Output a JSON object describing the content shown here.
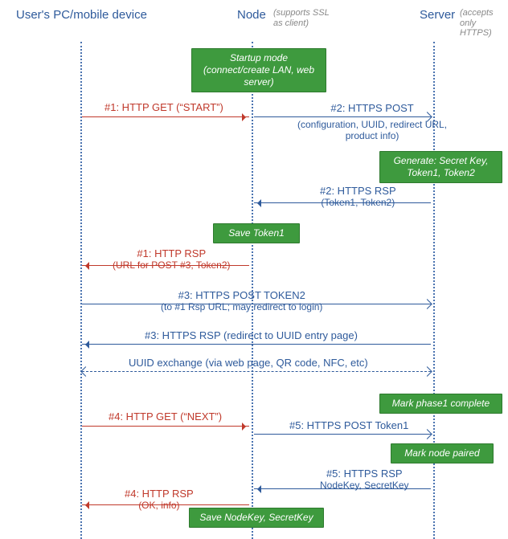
{
  "lanes": {
    "user": {
      "title": "User's PC/mobile device",
      "sub": ""
    },
    "node": {
      "title": "Node",
      "sub": "(supports SSL\nas client)"
    },
    "server": {
      "title": "Server",
      "sub": "(accepts\nonly HTTPS)"
    }
  },
  "boxes": {
    "startup": "Startup mode\n(connect/create LAN, web\nserver)",
    "gen": "Generate: Secret Key,\nToken1, Token2",
    "save1": "Save Token1",
    "phase1": "Mark phase1 complete",
    "paired": "Mark node paired",
    "save2": "Save NodeKey, SecretKey"
  },
  "messages": {
    "m1": {
      "t": "#1: HTTP GET (“START”)",
      "sub": ""
    },
    "m2": {
      "t": "#2: HTTPS POST",
      "sub": "(configuration, UUID, redirect URL,\nproduct info)"
    },
    "m2r": {
      "t": "#2: HTTPS RSP",
      "sub": "(Token1, Token2)"
    },
    "m1r": {
      "t": "#1: HTTP RSP",
      "sub": "(URL for POST #3, Token2)"
    },
    "m3": {
      "t": "#3: HTTPS POST TOKEN2",
      "sub": "(to #1 Rsp URL; may redirect to login)"
    },
    "m3r": {
      "t": "#3: HTTPS RSP (redirect to UUID entry page)",
      "sub": ""
    },
    "uuid": {
      "t": "UUID exchange (via web page, QR code, NFC, etc)",
      "sub": ""
    },
    "m4": {
      "t": "#4: HTTP GET (“NEXT”)",
      "sub": ""
    },
    "m5": {
      "t": "#5: HTTPS POST Token1",
      "sub": ""
    },
    "m5r": {
      "t": "#5: HTTPS RSP",
      "sub": "NodeKey, SecretKey"
    },
    "m4r": {
      "t": "#4: HTTP RSP",
      "sub": "(OK, info)"
    }
  },
  "chart_data": {
    "type": "sequence-diagram",
    "actors": [
      "User's PC/mobile device",
      "Node",
      "Server"
    ],
    "actor_notes": {
      "Node": "supports SSL as client",
      "Server": "accepts only HTTPS"
    },
    "steps": [
      {
        "kind": "state",
        "actor": "Node",
        "text": "Startup mode (connect/create LAN, web server)"
      },
      {
        "kind": "msg",
        "from": "User's PC/mobile device",
        "to": "Node",
        "proto": "HTTP",
        "label": "#1: HTTP GET (\"START\")"
      },
      {
        "kind": "msg",
        "from": "Node",
        "to": "Server",
        "proto": "HTTPS",
        "label": "#2: HTTPS POST",
        "detail": "configuration, UUID, redirect URL, product info"
      },
      {
        "kind": "state",
        "actor": "Server",
        "text": "Generate: Secret Key, Token1, Token2"
      },
      {
        "kind": "msg",
        "from": "Server",
        "to": "Node",
        "proto": "HTTPS",
        "label": "#2: HTTPS RSP",
        "detail": "Token1, Token2"
      },
      {
        "kind": "state",
        "actor": "Node",
        "text": "Save Token1"
      },
      {
        "kind": "msg",
        "from": "Node",
        "to": "User's PC/mobile device",
        "proto": "HTTP",
        "label": "#1: HTTP RSP",
        "detail": "URL for POST #3, Token2"
      },
      {
        "kind": "msg",
        "from": "User's PC/mobile device",
        "to": "Server",
        "proto": "HTTPS",
        "label": "#3: HTTPS POST TOKEN2",
        "detail": "to #1 Rsp URL; may redirect to login"
      },
      {
        "kind": "msg",
        "from": "Server",
        "to": "User's PC/mobile device",
        "proto": "HTTPS",
        "label": "#3: HTTPS RSP (redirect to UUID entry page)"
      },
      {
        "kind": "note",
        "between": [
          "User's PC/mobile device",
          "Server"
        ],
        "text": "UUID exchange (via web page, QR code, NFC, etc)",
        "style": "dashed"
      },
      {
        "kind": "state",
        "actor": "Server",
        "text": "Mark phase1 complete"
      },
      {
        "kind": "msg",
        "from": "User's PC/mobile device",
        "to": "Node",
        "proto": "HTTP",
        "label": "#4: HTTP GET (\"NEXT\")"
      },
      {
        "kind": "msg",
        "from": "Node",
        "to": "Server",
        "proto": "HTTPS",
        "label": "#5: HTTPS POST Token1"
      },
      {
        "kind": "state",
        "actor": "Server",
        "text": "Mark node paired"
      },
      {
        "kind": "msg",
        "from": "Server",
        "to": "Node",
        "proto": "HTTPS",
        "label": "#5: HTTPS RSP",
        "detail": "NodeKey, SecretKey"
      },
      {
        "kind": "msg",
        "from": "Node",
        "to": "User's PC/mobile device",
        "proto": "HTTP",
        "label": "#4: HTTP RSP",
        "detail": "OK, info"
      },
      {
        "kind": "state",
        "actor": "Node",
        "text": "Save NodeKey, SecretKey"
      }
    ]
  }
}
